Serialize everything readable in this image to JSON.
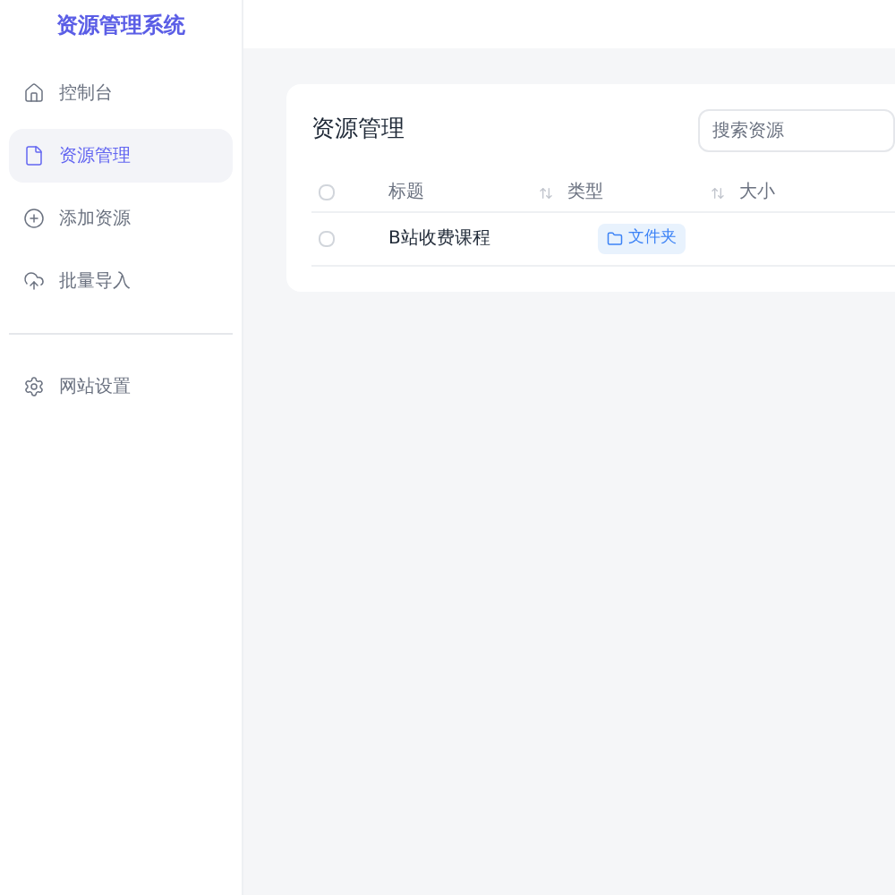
{
  "sidebar": {
    "title": "资源管理系统",
    "items": [
      {
        "label": "控制台",
        "selected": false
      },
      {
        "label": "资源管理",
        "selected": true
      },
      {
        "label": "添加资源",
        "selected": false
      },
      {
        "label": "批量导入",
        "selected": false
      }
    ],
    "bottom_items": [
      {
        "label": "网站设置",
        "selected": false
      }
    ]
  },
  "card": {
    "title": "资源管理",
    "search": {
      "placeholder": "搜索资源"
    },
    "table": {
      "header_checked": false,
      "columns": [
        {
          "label": "标题",
          "sortable": true
        },
        {
          "label": "类型",
          "sortable": true
        },
        {
          "label": "大小"
        }
      ],
      "rows": [
        {
          "checked": false,
          "title": "B站收费课程",
          "type": "文件夹"
        }
      ]
    }
  }
}
